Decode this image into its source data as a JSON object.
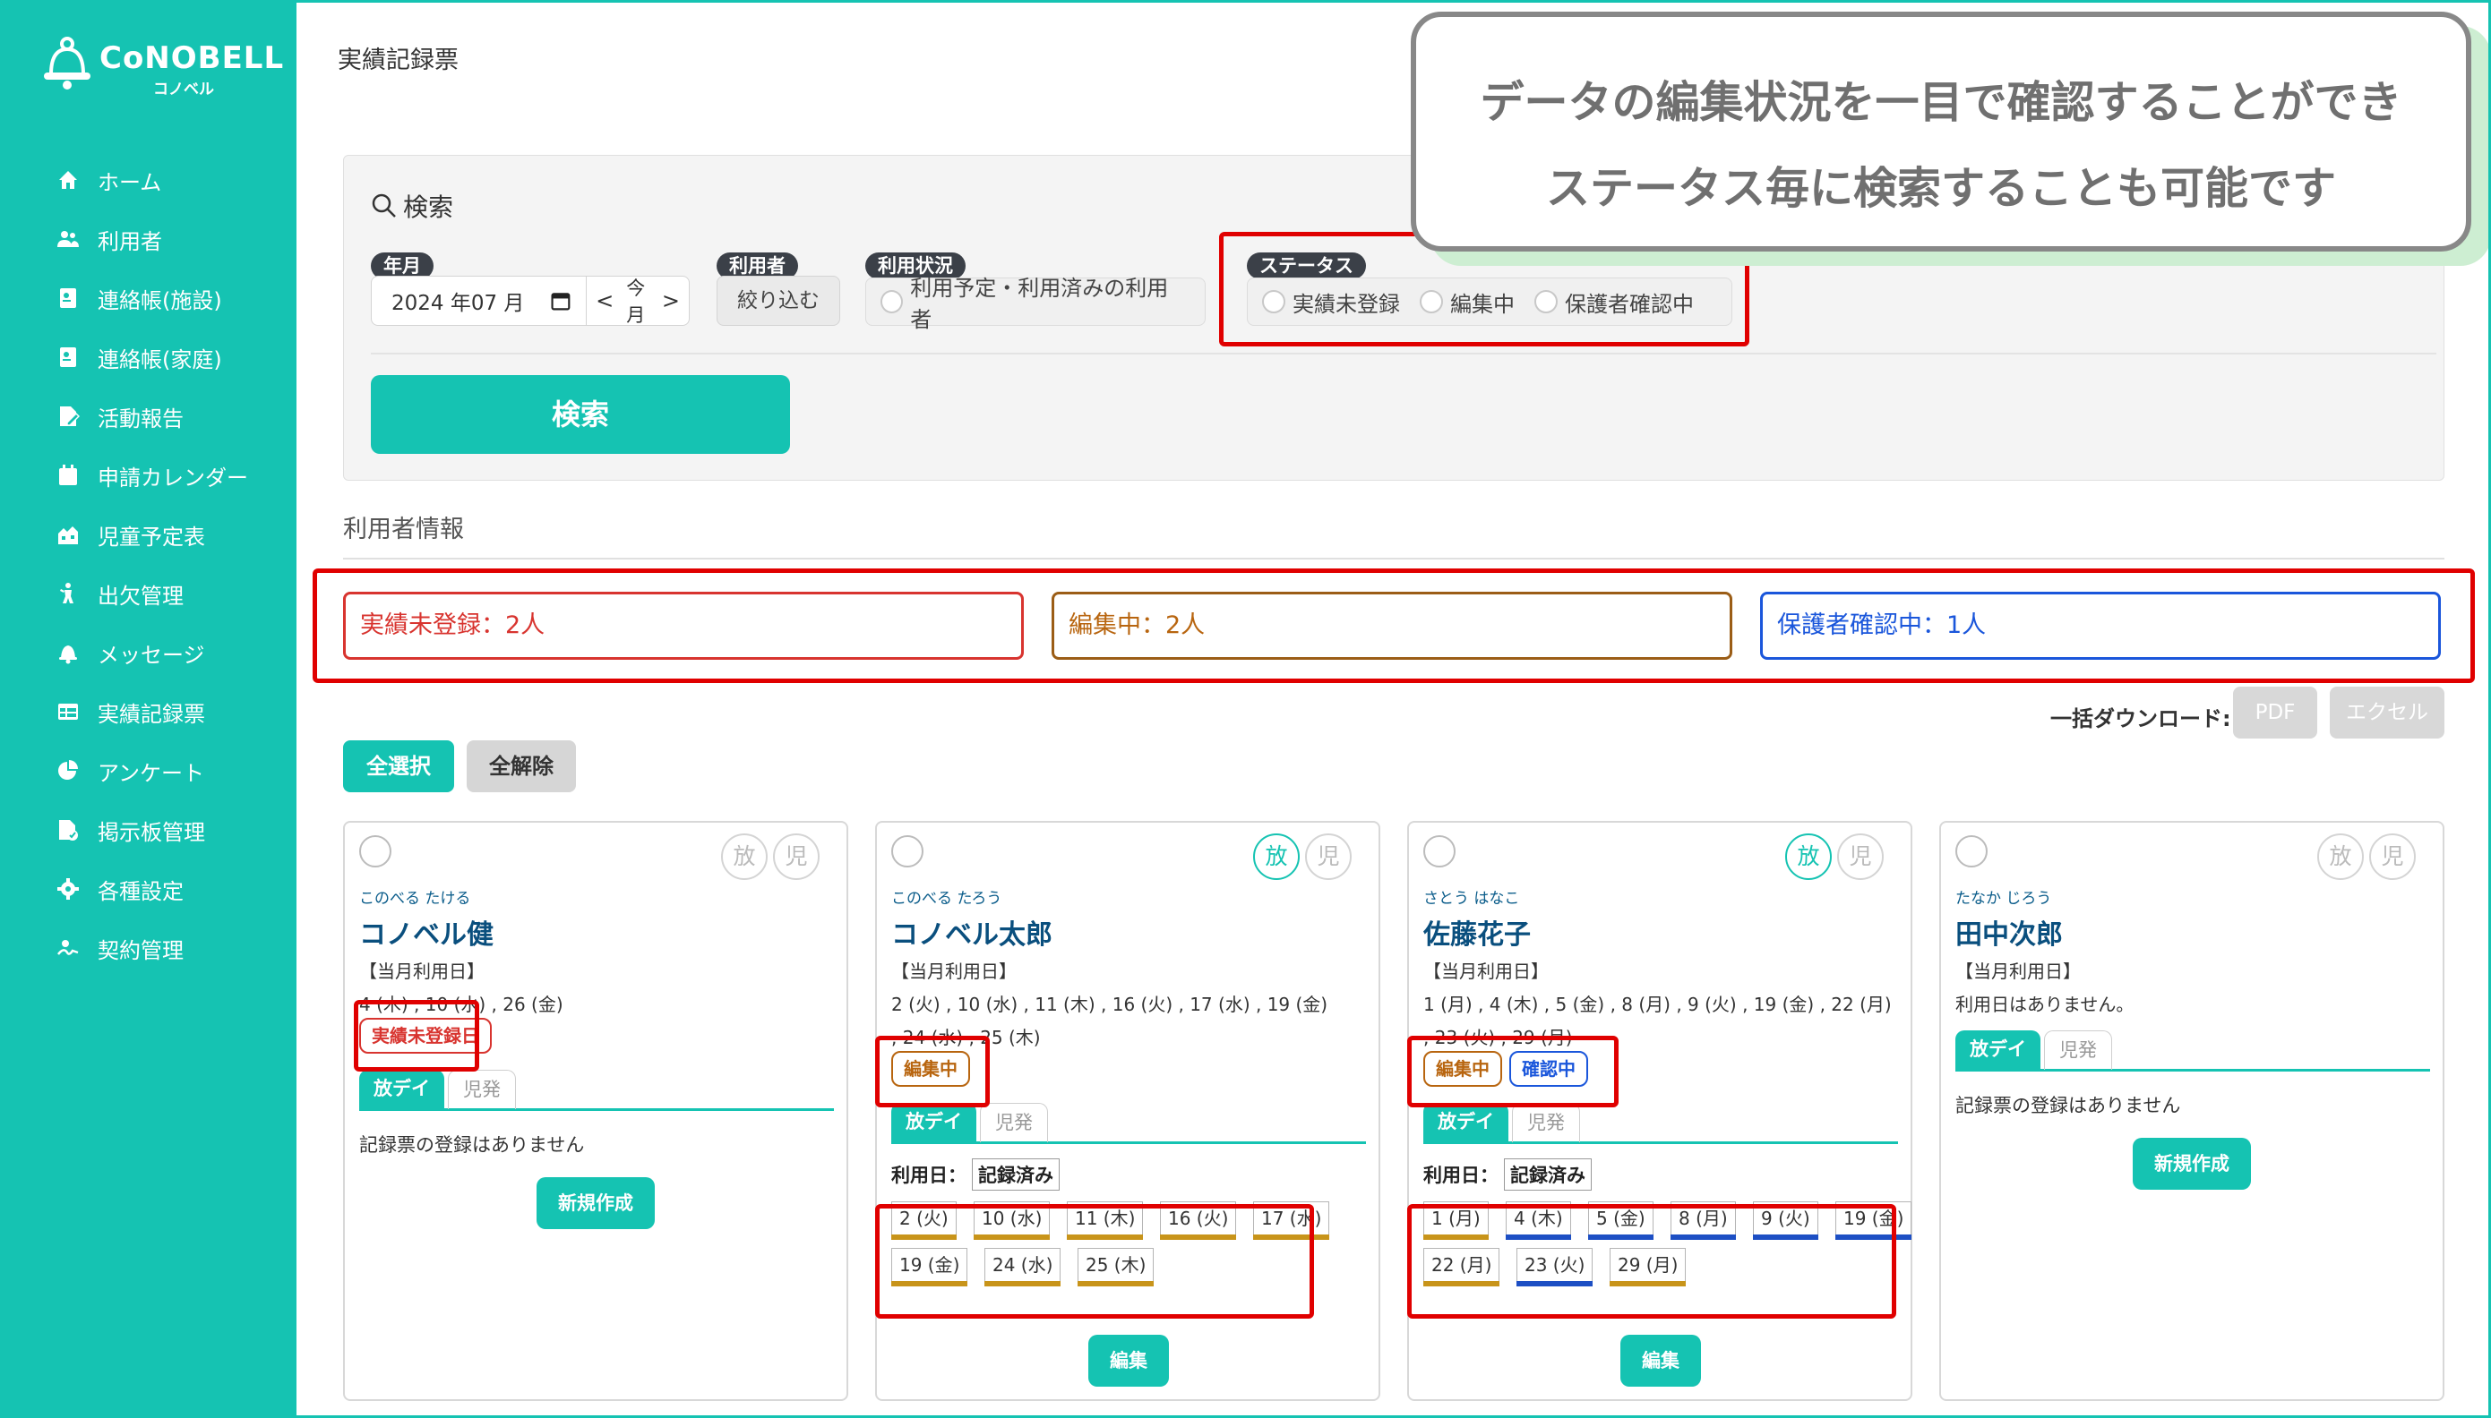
{
  "app": {
    "brand": "CoNOBELL",
    "brand_sub": "コノベル",
    "page_title": "実績記録票"
  },
  "colors": {
    "accent": "#15c3b2",
    "red": "#e00000",
    "orange": "#b8860b",
    "blue": "#1a56db"
  },
  "nav": [
    {
      "label": "ホーム",
      "icon": "home-icon"
    },
    {
      "label": "利用者",
      "icon": "users-icon"
    },
    {
      "label": "連絡帳(施設)",
      "icon": "contact-book-icon"
    },
    {
      "label": "連絡帳(家庭)",
      "icon": "contact-book-icon"
    },
    {
      "label": "活動報告",
      "icon": "report-icon"
    },
    {
      "label": "申請カレンダー",
      "icon": "calendar-icon"
    },
    {
      "label": "児童予定表",
      "icon": "schedule-icon"
    },
    {
      "label": "出欠管理",
      "icon": "attendance-icon"
    },
    {
      "label": "メッセージ",
      "icon": "bell-icon"
    },
    {
      "label": "実績記録票",
      "icon": "table-icon"
    },
    {
      "label": "アンケート",
      "icon": "pie-icon"
    },
    {
      "label": "掲示板管理",
      "icon": "board-icon"
    },
    {
      "label": "各種設定",
      "icon": "gear-icon"
    },
    {
      "label": "契約管理",
      "icon": "contract-icon"
    }
  ],
  "callout": {
    "line1": "データの編集状況を一目で確認することができ",
    "line2": "ステータス毎に検索することも可能です"
  },
  "search": {
    "title": "検索",
    "month_label": "年月",
    "month_value": "2024 年07 月",
    "prev": "<",
    "today": "今月",
    "next": ">",
    "user_label": "利用者",
    "filter_button": "絞り込む",
    "usage_label": "利用状況",
    "usage_option": "利用予定・利用済みの利用者",
    "status_label": "ステータス",
    "status_options": [
      "実績未登録",
      "編集中",
      "保護者確認中"
    ],
    "submit": "検索"
  },
  "user_info": {
    "title": "利用者情報",
    "summary": [
      "実績未登録：2人",
      "編集中：2人",
      "保護者確認中：1人"
    ],
    "download_label": "一括ダウンロード:",
    "pdf": "PDF",
    "excel": "エクセル",
    "select_all": "全選択",
    "deselect_all": "全解除"
  },
  "service_labels": {
    "hou": "放",
    "ji": "児"
  },
  "cards": [
    {
      "kana": "このべる たける",
      "name": "コノベル健",
      "heading": "【当月利用日】",
      "days": [
        "4 (木) , 10 (水) , 26 (金)"
      ],
      "badges": [
        {
          "text": "実績未登録日",
          "type": "red"
        }
      ],
      "tabs": [
        "放デイ",
        "児発"
      ],
      "empty": "記録票の登録はありません",
      "button": "新規作成",
      "hou_active": false
    },
    {
      "kana": "このべる たろう",
      "name": "コノベル太郎",
      "heading": "【当月利用日】",
      "days": [
        "2 (火) , 10 (水) , 11 (木) , 16 (火) , 17 (水) , 19 (金)",
        ", 24 (水) , 25 (木)"
      ],
      "badges": [
        {
          "text": "編集中",
          "type": "orange"
        }
      ],
      "tabs": [
        "放デイ",
        "児発"
      ],
      "use_label": "利用日：",
      "recorded": "記録済み",
      "date_chips": [
        {
          "t": "2 (火)",
          "s": "orange"
        },
        {
          "t": "10 (水)",
          "s": "orange"
        },
        {
          "t": "11 (木)",
          "s": "orange"
        },
        {
          "t": "16 (火)",
          "s": "orange"
        },
        {
          "t": "17 (水)",
          "s": "orange"
        },
        {
          "t": "19 (金)",
          "s": "orange"
        },
        {
          "t": "24 (水)",
          "s": "orange"
        },
        {
          "t": "25 (木)",
          "s": "orange"
        }
      ],
      "button": "編集",
      "hou_active": true
    },
    {
      "kana": "さとう はなこ",
      "name": "佐藤花子",
      "heading": "【当月利用日】",
      "days": [
        "1 (月) , 4 (木) , 5 (金) , 8 (月) , 9 (火) , 19 (金) , 22 (月)",
        ", 23 (火) , 29 (月)"
      ],
      "badges": [
        {
          "text": "編集中",
          "type": "orange"
        },
        {
          "text": "確認中",
          "type": "blue"
        }
      ],
      "tabs": [
        "放デイ",
        "児発"
      ],
      "use_label": "利用日：",
      "recorded": "記録済み",
      "date_chips": [
        {
          "t": "1 (月)",
          "s": "orange"
        },
        {
          "t": "4 (木)",
          "s": "blue"
        },
        {
          "t": "5 (金)",
          "s": "blue"
        },
        {
          "t": "8 (月)",
          "s": "blue"
        },
        {
          "t": "9 (火)",
          "s": "blue"
        },
        {
          "t": "19 (金)",
          "s": "blue"
        },
        {
          "t": "22 (月)",
          "s": "orange"
        },
        {
          "t": "23 (火)",
          "s": "blue"
        },
        {
          "t": "29 (月)",
          "s": "orange"
        }
      ],
      "button": "編集",
      "hou_active": true
    },
    {
      "kana": "たなか じろう",
      "name": "田中次郎",
      "heading": "【当月利用日】",
      "days": [
        "利用日はありません。"
      ],
      "badges": [],
      "tabs": [
        "放デイ",
        "児発"
      ],
      "empty": "記録票の登録はありません",
      "button": "新規作成",
      "hou_active": false
    }
  ]
}
